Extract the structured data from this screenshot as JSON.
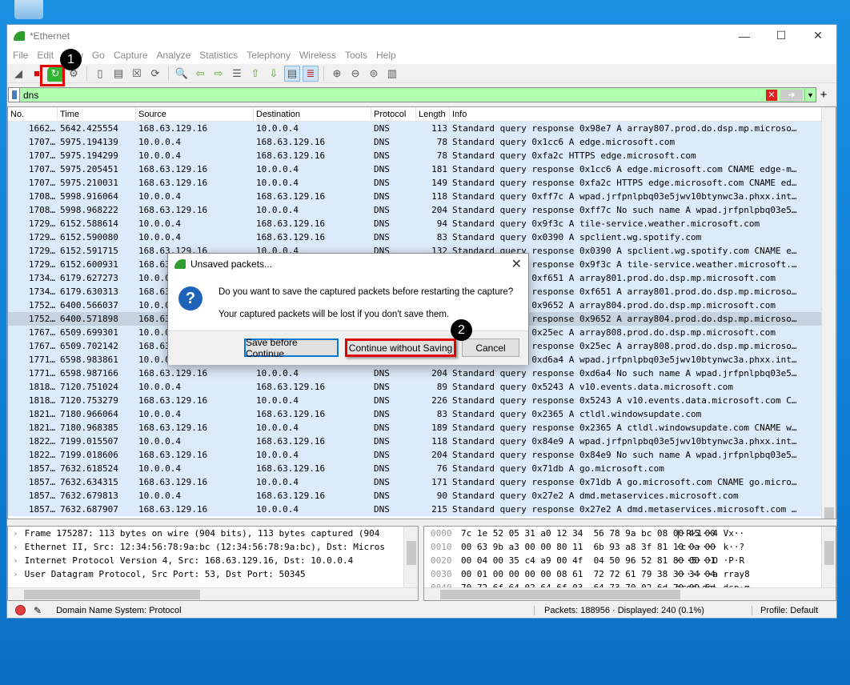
{
  "window": {
    "title": "*Ethernet"
  },
  "menu": [
    "File",
    "Edit",
    "View",
    "Go",
    "Capture",
    "Analyze",
    "Statistics",
    "Telephony",
    "Wireless",
    "Tools",
    "Help"
  ],
  "toolbar": [
    "shark-fin-start-icon",
    "stop-icon",
    "restart-icon",
    "options-gear-icon",
    "open-file-icon",
    "save-file-icon",
    "close-file-icon",
    "reload-icon",
    "find-packet-icon",
    "go-back-icon",
    "go-forward-icon",
    "go-to-packet-icon",
    "first-packet-icon",
    "last-packet-icon",
    "autoscroll-icon",
    "colorize-icon",
    "zoom-in-icon",
    "zoom-out-icon",
    "normal-size-icon",
    "resize-columns-icon"
  ],
  "filter": {
    "value": "dns"
  },
  "columns": [
    "No.",
    "Time",
    "Source",
    "Destination",
    "Protocol",
    "Length",
    "Info"
  ],
  "rows": [
    [
      "1662…",
      "5642.425554",
      "168.63.129.16",
      "10.0.0.4",
      "DNS",
      "113",
      "Standard query response 0x98e7 A array807.prod.do.dsp.mp.microso…"
    ],
    [
      "1707…",
      "5975.194139",
      "10.0.0.4",
      "168.63.129.16",
      "DNS",
      "78",
      "Standard query 0x1cc6 A edge.microsoft.com"
    ],
    [
      "1707…",
      "5975.194299",
      "10.0.0.4",
      "168.63.129.16",
      "DNS",
      "78",
      "Standard query 0xfa2c HTTPS edge.microsoft.com"
    ],
    [
      "1707…",
      "5975.205451",
      "168.63.129.16",
      "10.0.0.4",
      "DNS",
      "181",
      "Standard query response 0x1cc6 A edge.microsoft.com CNAME edge-m…"
    ],
    [
      "1707…",
      "5975.210031",
      "168.63.129.16",
      "10.0.0.4",
      "DNS",
      "149",
      "Standard query response 0xfa2c HTTPS edge.microsoft.com CNAME ed…"
    ],
    [
      "1708…",
      "5998.916064",
      "10.0.0.4",
      "168.63.129.16",
      "DNS",
      "118",
      "Standard query 0xff7c A wpad.jrfpnlpbq03e5jwv10btynwc3a.phxx.int…"
    ],
    [
      "1708…",
      "5998.968222",
      "168.63.129.16",
      "10.0.0.4",
      "DNS",
      "204",
      "Standard query response 0xff7c No such name A wpad.jrfpnlpbq03e5…"
    ],
    [
      "1729…",
      "6152.588614",
      "10.0.0.4",
      "168.63.129.16",
      "DNS",
      "94",
      "Standard query 0x9f3c A tile-service.weather.microsoft.com"
    ],
    [
      "1729…",
      "6152.590080",
      "10.0.0.4",
      "168.63.129.16",
      "DNS",
      "83",
      "Standard query 0x0390 A spclient.wg.spotify.com"
    ],
    [
      "1729…",
      "6152.591715",
      "168.63.129.16",
      "10.0.0.4",
      "DNS",
      "132",
      "Standard query response 0x0390 A spclient.wg.spotify.com CNAME e…"
    ],
    [
      "1729…",
      "6152.600931",
      "168.63.129.16",
      "10.0.0.4",
      "DNS",
      "",
      "Standard query response 0x9f3c A tile-service.weather.microsoft.…"
    ],
    [
      "1734…",
      "6179.627273",
      "10.0.0.4",
      "168.63.129.16",
      "DNS",
      "",
      "Standard query 0xf651 A array801.prod.do.dsp.mp.microsoft.com"
    ],
    [
      "1734…",
      "6179.630313",
      "168.63.129.16",
      "10.0.0.4",
      "DNS",
      "",
      "Standard query response 0xf651 A array801.prod.do.dsp.mp.microso…"
    ],
    [
      "1752…",
      "6400.566037",
      "10.0.0.4",
      "168.63.129.16",
      "DNS",
      "",
      "Standard query 0x9652 A array804.prod.do.dsp.mp.microsoft.com"
    ],
    [
      "1752…",
      "6400.571898",
      "168.63.129.16",
      "10.0.0.4",
      "DNS",
      "",
      "Standard query response 0x9652 A array804.prod.do.dsp.mp.microso…"
    ],
    [
      "1767…",
      "6509.699301",
      "10.0.0.4",
      "168.63.129.16",
      "DNS",
      "",
      "Standard query 0x25ec A array808.prod.do.dsp.mp.microsoft.com"
    ],
    [
      "1767…",
      "6509.702142",
      "168.63.129.16",
      "10.0.0.4",
      "DNS",
      "",
      "Standard query response 0x25ec A array808.prod.do.dsp.mp.microso…"
    ],
    [
      "1771…",
      "6598.983861",
      "10.0.0.4",
      "168.63.129.16",
      "DNS",
      "",
      "Standard query 0xd6a4 A wpad.jrfpnlpbq03e5jwv10btynwc3a.phxx.int…"
    ],
    [
      "1771…",
      "6598.987166",
      "168.63.129.16",
      "10.0.0.4",
      "DNS",
      "204",
      "Standard query response 0xd6a4 No such name A wpad.jrfpnlpbq03e5…"
    ],
    [
      "1818…",
      "7120.751024",
      "10.0.0.4",
      "168.63.129.16",
      "DNS",
      "89",
      "Standard query 0x5243 A v10.events.data.microsoft.com"
    ],
    [
      "1818…",
      "7120.753279",
      "168.63.129.16",
      "10.0.0.4",
      "DNS",
      "226",
      "Standard query response 0x5243 A v10.events.data.microsoft.com C…"
    ],
    [
      "1821…",
      "7180.966064",
      "10.0.0.4",
      "168.63.129.16",
      "DNS",
      "83",
      "Standard query 0x2365 A ctldl.windowsupdate.com"
    ],
    [
      "1821…",
      "7180.968385",
      "168.63.129.16",
      "10.0.0.4",
      "DNS",
      "189",
      "Standard query response 0x2365 A ctldl.windowsupdate.com CNAME w…"
    ],
    [
      "1822…",
      "7199.015507",
      "10.0.0.4",
      "168.63.129.16",
      "DNS",
      "118",
      "Standard query 0x84e9 A wpad.jrfpnlpbq03e5jwv10btynwc3a.phxx.int…"
    ],
    [
      "1822…",
      "7199.018606",
      "168.63.129.16",
      "10.0.0.4",
      "DNS",
      "204",
      "Standard query response 0x84e9 No such name A wpad.jrfpnlpbq03e5…"
    ],
    [
      "1857…",
      "7632.618524",
      "10.0.0.4",
      "168.63.129.16",
      "DNS",
      "76",
      "Standard query 0x71db A go.microsoft.com"
    ],
    [
      "1857…",
      "7632.634315",
      "168.63.129.16",
      "10.0.0.4",
      "DNS",
      "171",
      "Standard query response 0x71db A go.microsoft.com CNAME go.micro…"
    ],
    [
      "1857…",
      "7632.679813",
      "10.0.0.4",
      "168.63.129.16",
      "DNS",
      "90",
      "Standard query 0x27e2 A dmd.metaservices.microsoft.com"
    ],
    [
      "1857…",
      "7632.687907",
      "168.63.129.16",
      "10.0.0.4",
      "DNS",
      "215",
      "Standard query response 0x27e2 A dmd.metaservices.microsoft.com …"
    ]
  ],
  "selected_row": 14,
  "details": [
    "Frame 175287: 113 bytes on wire (904 bits), 113 bytes captured (904",
    "Ethernet II, Src: 12:34:56:78:9a:bc (12:34:56:78:9a:bc), Dst: Micros",
    "Internet Protocol Version 4, Src: 168.63.129.16, Dst: 10.0.0.4",
    "User Datagram Protocol, Src Port: 53, Dst Port: 50345"
  ],
  "hex": [
    {
      "off": "0000",
      "hex": "7c 1e 52 05 31 a0 12 34  56 78 9a bc 08 00 45 00",
      "ascii": "|·R·1··4 Vx··"
    },
    {
      "off": "0010",
      "hex": "00 63 9b a3 00 00 80 11  6b 93 a8 3f 81 10 0a 00",
      "ascii": "·c······ k··?"
    },
    {
      "off": "0020",
      "hex": "00 04 00 35 c4 a9 00 4f  04 50 96 52 81 80 00 01",
      "ascii": "···5···O ·P·R"
    },
    {
      "off": "0030",
      "hex": "00 01 00 00 00 00 08 61  72 72 61 79 38 30 34 04",
      "ascii": "·······a rray8"
    },
    {
      "off": "0040",
      "hex": "70 72 6f 64 02 64 6f 03  64 73 70 02 6d 70 09 6d",
      "ascii": "prod·do· dsp·m"
    }
  ],
  "status": {
    "field": "Domain Name System: Protocol",
    "packets": "Packets: 188956 · Displayed: 240 (0.1%)",
    "profile": "Profile: Default"
  },
  "dialog": {
    "title": "Unsaved packets...",
    "question": "Do you want to save the captured packets before restarting the capture?",
    "warning": "Your captured packets will be lost if you don't save them.",
    "save_label": "Save before Continue",
    "continue_label": "Continue without Saving",
    "cancel_label": "Cancel"
  },
  "badges": {
    "one": "1",
    "two": "2"
  },
  "colors": {
    "filter_bg": "#afffaf",
    "row_bg": "#dcebfa",
    "highlight": "#e00000"
  }
}
